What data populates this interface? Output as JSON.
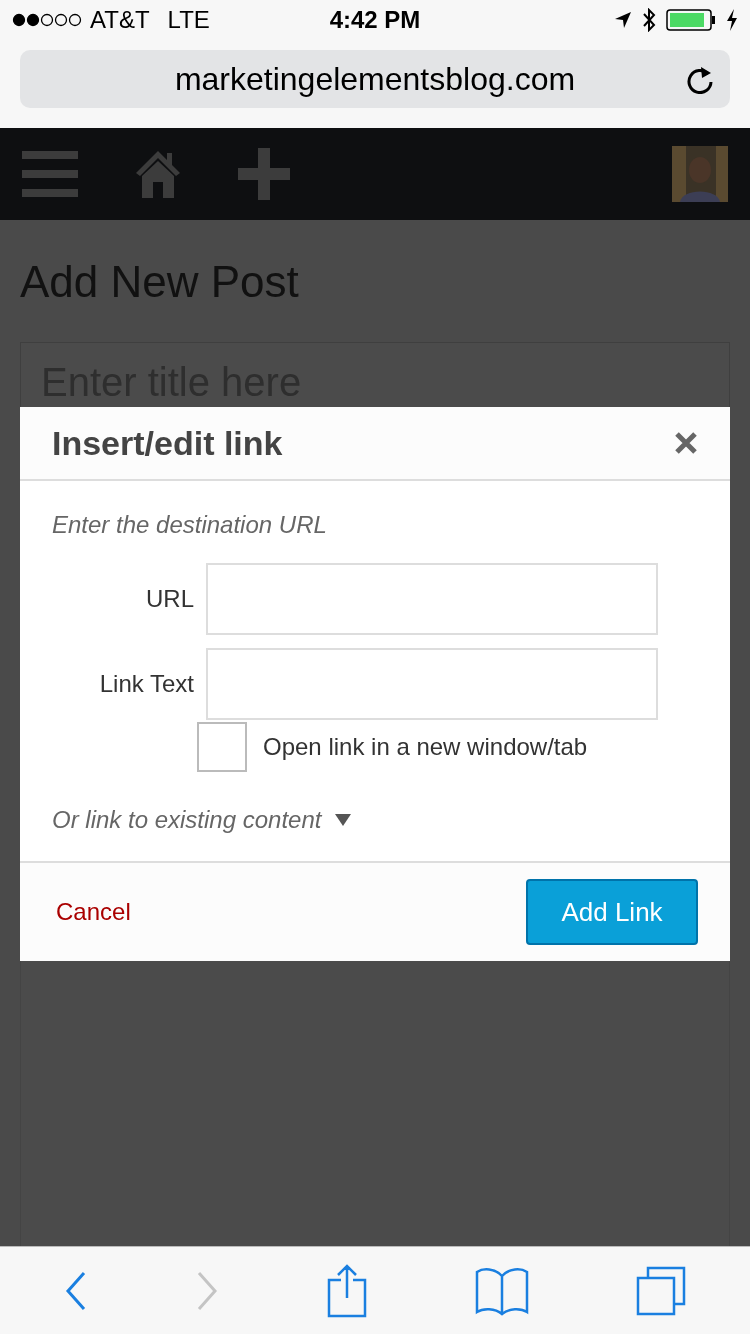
{
  "status_bar": {
    "carrier": "AT&T",
    "network": "LTE",
    "time": "4:42 PM"
  },
  "address_bar": {
    "url": "marketingelementsblog.com"
  },
  "page": {
    "heading": "Add New Post",
    "title_field": {
      "placeholder": "Enter title here"
    }
  },
  "dialog": {
    "title": "Insert/edit link",
    "hint": "Enter the destination URL",
    "fields": [
      {
        "label": "URL"
      },
      {
        "label": "Link Text"
      }
    ],
    "new_window": {
      "label": "Open link in a new window/tab",
      "checked": false
    },
    "existing_content": {
      "label": "Or link to existing content",
      "expanded": false
    },
    "cancel": "Cancel",
    "submit": "Add Link"
  },
  "toolbar": [
    {
      "kind": "back",
      "disabled": false
    },
    {
      "kind": "forward",
      "disabled": true
    },
    {
      "kind": "share",
      "disabled": false
    },
    {
      "kind": "bookmarks",
      "disabled": false
    },
    {
      "kind": "tabs",
      "disabled": false
    }
  ]
}
